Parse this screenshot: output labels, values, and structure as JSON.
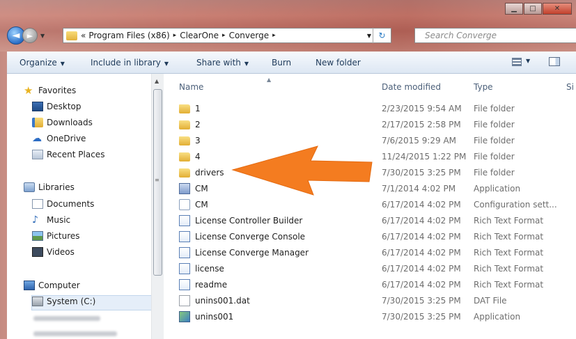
{
  "window": {
    "controls": [
      "▁",
      "□",
      "✕"
    ]
  },
  "address": {
    "prefix": "«",
    "segments": [
      "Program Files (x86)",
      "ClearOne",
      "Converge"
    ],
    "separator": "▸"
  },
  "search": {
    "placeholder": "Search Converge"
  },
  "toolbar": {
    "organize": "Organize",
    "include_in_library": "Include in library",
    "share_with": "Share with",
    "burn": "Burn",
    "new_folder": "New folder"
  },
  "navpane": {
    "favorites": "Favorites",
    "desktop": "Desktop",
    "downloads": "Downloads",
    "onedrive": "OneDrive",
    "recent_places": "Recent Places",
    "libraries": "Libraries",
    "documents": "Documents",
    "music": "Music",
    "pictures": "Pictures",
    "videos": "Videos",
    "computer": "Computer",
    "system_c": "System (C:)"
  },
  "columns": {
    "name": "Name",
    "date_modified": "Date modified",
    "type": "Type",
    "size": "Si"
  },
  "files": [
    {
      "name": "1",
      "date": "2/23/2015 9:54 AM",
      "type": "File folder",
      "icon": "folder-icon"
    },
    {
      "name": "2",
      "date": "2/17/2015 2:58 PM",
      "type": "File folder",
      "icon": "folder-icon"
    },
    {
      "name": "3",
      "date": "7/6/2015 9:29 AM",
      "type": "File folder",
      "icon": "folder-icon"
    },
    {
      "name": "4",
      "date": "11/24/2015 1:22 PM",
      "type": "File folder",
      "icon": "folder-icon"
    },
    {
      "name": "drivers",
      "date": "7/30/2015 3:25 PM",
      "type": "File folder",
      "icon": "folder-icon"
    },
    {
      "name": "CM",
      "date": "7/1/2014 4:02 PM",
      "type": "Application",
      "icon": "application-icon"
    },
    {
      "name": "CM",
      "date": "6/17/2014 4:02 PM",
      "type": "Configuration sett...",
      "icon": "config-file-icon"
    },
    {
      "name": "License Controller Builder",
      "date": "6/17/2014 4:02 PM",
      "type": "Rich Text Format",
      "icon": "rtf-document-icon"
    },
    {
      "name": "License Converge Console",
      "date": "6/17/2014 4:02 PM",
      "type": "Rich Text Format",
      "icon": "rtf-document-icon"
    },
    {
      "name": "License Converge Manager",
      "date": "6/17/2014 4:02 PM",
      "type": "Rich Text Format",
      "icon": "rtf-document-icon"
    },
    {
      "name": "license",
      "date": "6/17/2014 4:02 PM",
      "type": "Rich Text Format",
      "icon": "rtf-document-icon"
    },
    {
      "name": "readme",
      "date": "6/17/2014 4:02 PM",
      "type": "Rich Text Format",
      "icon": "rtf-document-icon"
    },
    {
      "name": "unins001.dat",
      "date": "7/30/2015 3:25 PM",
      "type": "DAT File",
      "icon": "dat-file-icon"
    },
    {
      "name": "unins001",
      "date": "7/30/2015 3:25 PM",
      "type": "Application",
      "icon": "setup-application-icon"
    }
  ],
  "annotation": {
    "arrow_color": "#f47c20",
    "points_to": "drivers"
  }
}
